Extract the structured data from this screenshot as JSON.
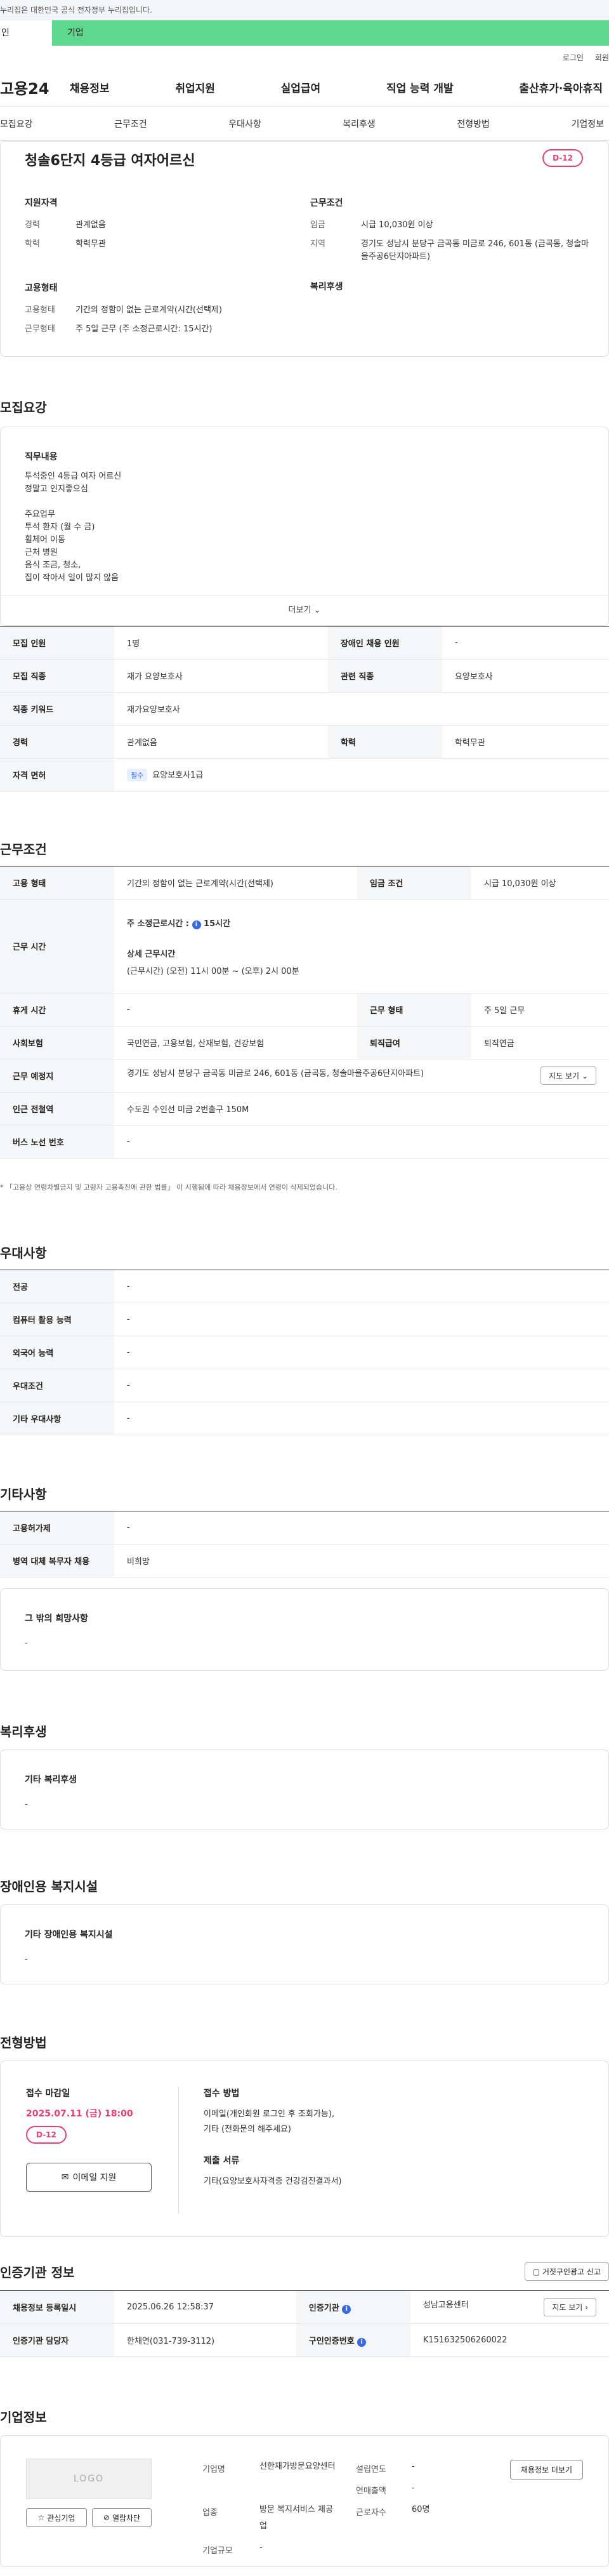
{
  "gov_banner": "누리집은 대한민국 공식 전자정부 누리집입니다.",
  "user_type": {
    "personal": "인",
    "company": "기업"
  },
  "util": {
    "login": "로그인",
    "join": "회원"
  },
  "header": {
    "logo": "고용24",
    "menu": [
      "채용정보",
      "취업지원",
      "실업급여",
      "직업 능력 개발",
      "출산휴가·육아휴직"
    ]
  },
  "subnav": [
    "모집요강",
    "근무조건",
    "우대사항",
    "복리후생",
    "전형방법",
    "기업정보"
  ],
  "summary": {
    "title": "청솔6단지 4등급 여자어르신",
    "dday": "D-12",
    "qual_h": "지원자격",
    "career_k": "경력",
    "career_v": "관계없음",
    "edu_k": "학력",
    "edu_v": "학력무관",
    "cond_h": "근무조건",
    "wage_k": "임금",
    "wage_v": "시급 10,030원 이상",
    "area_k": "지역",
    "area_v": "경기도 성남시 분당구 금곡동 미금로 246, 601동 (금곡동, 청솔마을주공6단지아파트)",
    "emp_h": "고용형태",
    "type_k": "고용형태",
    "type_v": "기간의 정함이 없는 근로계약(시간(선택제)",
    "shape_k": "근무형태",
    "shape_v": "주 5일 근무 (주 소정근로시간: 15시간)",
    "welfare_h": "복리후생"
  },
  "recruit": {
    "title": "모집요강",
    "duty_h": "직무내용",
    "duty_text": "투석중인 4등급 여자 어르신\n정말고 인지좋으심\n\n주요업무\n투석 환자 (월 수 금)\n휠체어 이동\n근처 병원\n음식 조금, 청소,\n집이 작아서 일이 많지 않음",
    "more": "더보기",
    "rows": [
      {
        "k1": "모집 인원",
        "v1": "1명",
        "k2": "장애인 채용 인원",
        "v2": "-"
      },
      {
        "k1": "모집 직종",
        "v1": "재가 요양보호사",
        "k2": "관련 직종",
        "v2": "요양보호사"
      },
      {
        "k1": "직종 키워드",
        "v1": "재가요양보호사"
      },
      {
        "k1": "경력",
        "v1": "관계없음",
        "k2": "학력",
        "v2": "학력무관"
      },
      {
        "k1": "자격 면허",
        "badge": "필수",
        "v1": "요양보호사1급"
      }
    ]
  },
  "work": {
    "title": "근무조건",
    "type_k": "고용 형태",
    "type_v": "기간의 정함이 없는 근로계약(시간(선택제)",
    "wage_k": "임금 조건",
    "wage_v": "시급 10,030원 이상",
    "hours_k": "근무 시간",
    "hours_week": "주 소정근로시간 :",
    "hours_week_v": "15시간",
    "hours_detail_h": "상세 근무시간",
    "hours_detail_v": "(근무시간) (오전) 11시 00분 ~ (오후) 2시 00분",
    "rest_k": "휴게 시간",
    "rest_v": "-",
    "shape_k": "근무 형태",
    "shape_v": "주 5일 근무",
    "ins_k": "사회보험",
    "ins_v": "국민연금, 고용보험, 산재보험, 건강보험",
    "ret_k": "퇴직급여",
    "ret_v": "퇴직연금",
    "place_k": "근무 예정지",
    "place_v": "경기도 성남시 분당구 금곡동 미금로 246, 601동 (금곡동, 청솔마을주공6단지아파트)",
    "map_btn": "지도 보기",
    "subway_k": "인근 전철역",
    "subway_v": "수도권 수인선 미금 2번출구 150M",
    "bus_k": "버스 노선 번호",
    "bus_v": "-",
    "note": "* 「고용상 연령차별금지 및 고령자 고용촉진에 관한 법률」 이 시행됨에 따라 채용정보에서 연령이 삭제되었습니다."
  },
  "pref": {
    "title": "우대사항",
    "rows": [
      {
        "k": "전공",
        "v": "-"
      },
      {
        "k": "컴퓨터 활용 능력",
        "v": "-"
      },
      {
        "k": "외국어 능력",
        "v": "-"
      },
      {
        "k": "우대조건",
        "v": "-"
      },
      {
        "k": "기타 우대사항",
        "v": "-"
      }
    ]
  },
  "etc": {
    "title": "기타사항",
    "rows": [
      {
        "k": "고용허가제",
        "v": "-"
      },
      {
        "k": "병역 대체 복무자 채용",
        "v": "비희망"
      }
    ],
    "other_h": "그 밖의 희망사항",
    "other_v": "-"
  },
  "welfare": {
    "title": "복리후생",
    "h": "기타 복리후생",
    "v": "-"
  },
  "disabled": {
    "title": "장애인용 복지시설",
    "h": "기타 장애인용 복지시설",
    "v": "-"
  },
  "apply": {
    "title": "전형방법",
    "deadline_h": "접수 마감일",
    "deadline_v": "2025.07.11 (금) 18:00",
    "dday": "D-12",
    "email_btn": "이메일 지원",
    "method_h": "접수 방법",
    "method_v1": "이메일(개인회원 로그인 후 조회가능),",
    "method_v2": "기타 (전화문의 해주세요)",
    "docs_h": "제출 서류",
    "docs_v": "기타(요양보호사자격증 건강검진결과서)"
  },
  "cert": {
    "title": "인증기관 정보",
    "report_btn": "거짓구인광고 신고",
    "reg_k": "채용정보 등록일시",
    "reg_v": "2025.06.26 12:58:37",
    "org_k": "인증기관",
    "org_v": "성남고용센터",
    "map_btn": "지도 보기",
    "staff_k": "인증기관 담당자",
    "staff_v": "한채연(031-739-3112)",
    "num_k": "구인인증번호",
    "num_v": "K151632506260022"
  },
  "company": {
    "title": "기업정보",
    "logo": "LOGO",
    "fav_btn": "관심기업",
    "block_btn": "열람차단",
    "name_k": "기업명",
    "name_v": "선한재가방문요양센터",
    "year_k": "설립연도",
    "year_v": "-",
    "sales_k": "연매출액",
    "sales_v": "-",
    "ind_k": "업종",
    "ind_v": "방문 복지서비스 제공업",
    "emp_k": "근로자수",
    "emp_v": "60명",
    "size_k": "기업규모",
    "size_v": "-",
    "info_btn": "채용정보 더보기"
  }
}
